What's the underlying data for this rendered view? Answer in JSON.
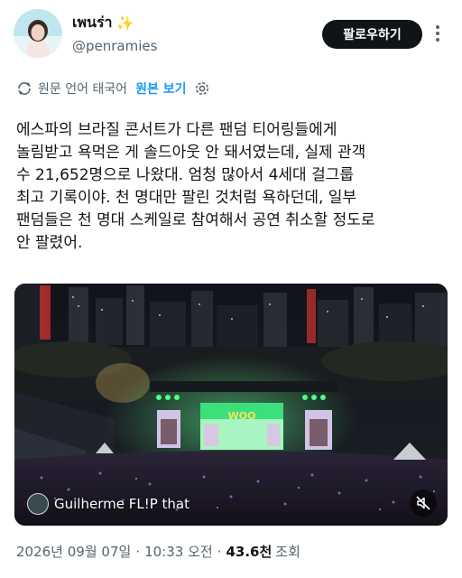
{
  "colors": {
    "text": "#0f1419",
    "secondary": "#536471",
    "accent": "#1d9bf0",
    "follow_bg": "#0f1419",
    "stage_green": "#32d46a"
  },
  "author": {
    "display_name": "เพนร่า",
    "emoji": "✨",
    "handle": "@penramies",
    "avatar_icon": "profile-avatar"
  },
  "header": {
    "follow_label": "팔로우하기",
    "more_icon": "more-vertical-icon"
  },
  "translation": {
    "icon": "translate-icon",
    "label": "원문 언어 태국어",
    "show_original": "원본 보기",
    "settings_icon": "gear-icon"
  },
  "tweet": {
    "lines": [
      "에스파의 브라질 콘서트가 다른 팬덤 티어링들에게",
      "놀림받고 욕먹은 게 솔드아웃 안 돼서였는데, 실제 관객",
      "수 21,652명으로 나왔대. 엄청 많아서 4세대 걸그룹",
      "최고 기록이야. 천 명대만 팔린 것처럼 욕하던데, 일부",
      "팬덤들은 천 명대 스케일로 참여해서 공연 취소할 정도로",
      "안 팔렸어."
    ]
  },
  "media": {
    "credit": "Guilherme FL!P that",
    "mute_icon": "muted-speaker-icon",
    "stage_text": "WOO"
  },
  "meta": {
    "date": "2026년 09월 07일",
    "time": "10:33 오전",
    "views_count": "43.6천",
    "views_label": "조회"
  }
}
